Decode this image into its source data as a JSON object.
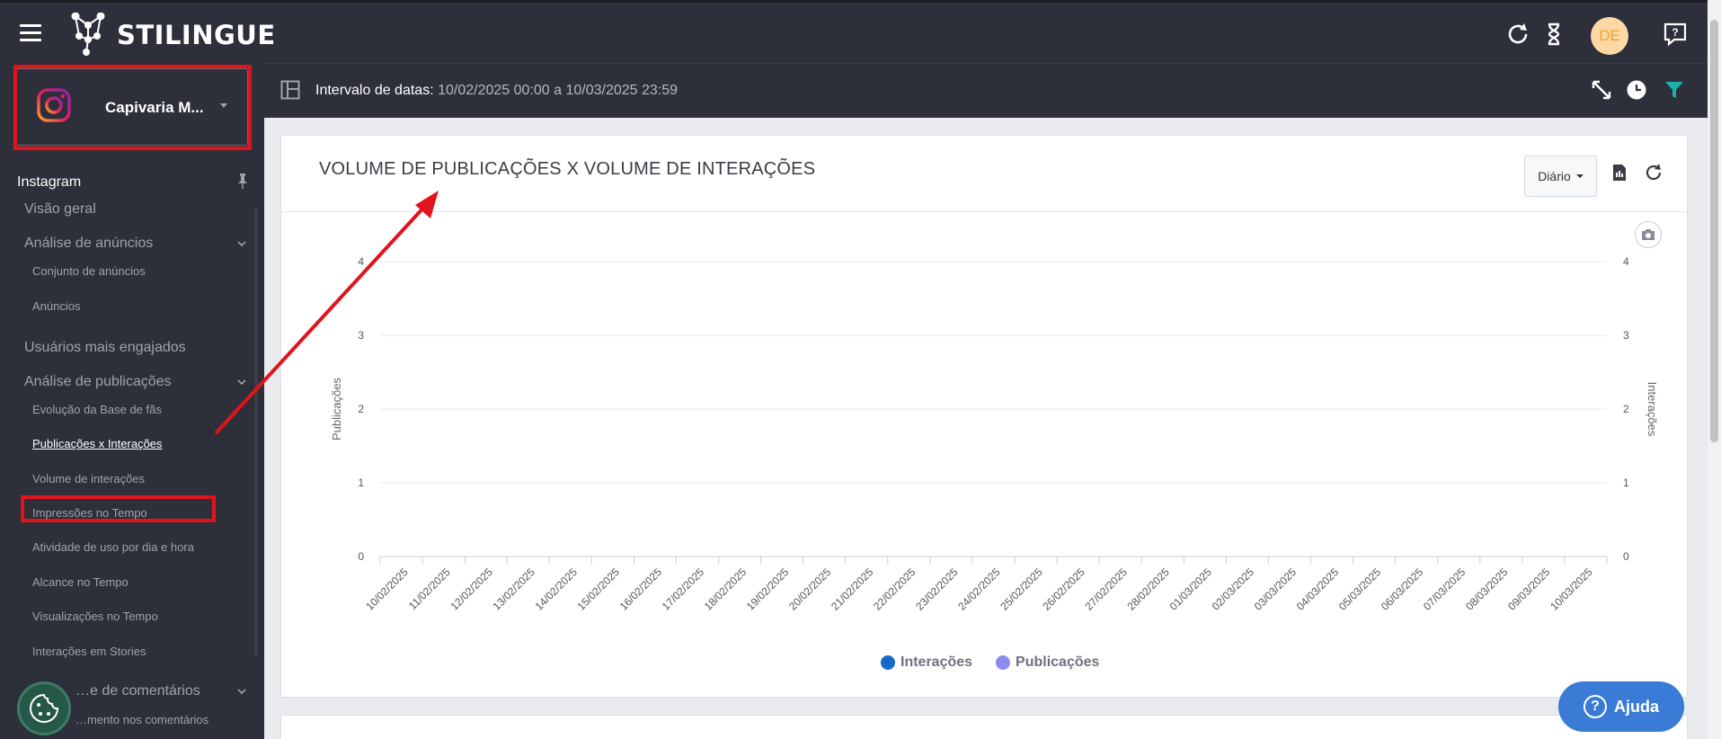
{
  "header": {
    "logo_text": "STILINGUE",
    "avatar_initials": "DE"
  },
  "account": {
    "name": "Capivaria M..."
  },
  "sidebar": {
    "section": "Instagram",
    "items": [
      {
        "label": "Visão geral"
      },
      {
        "label": "Análise de anúncios"
      },
      {
        "label": "Conjunto de anúncios"
      },
      {
        "label": "Anúncios"
      },
      {
        "label": "Usuários mais engajados"
      },
      {
        "label": "Análise de publicações"
      },
      {
        "label": "Evolução da Base de fãs"
      },
      {
        "label": "Publicações x Interações"
      },
      {
        "label": "Volume de interações"
      },
      {
        "label": "Impressões no Tempo"
      },
      {
        "label": "Atividade de uso por dia e hora"
      },
      {
        "label": "Alcance no Tempo"
      },
      {
        "label": "Visualizações no Tempo"
      },
      {
        "label": "Interações em Stories"
      },
      {
        "label": "…e de comentários"
      },
      {
        "label": "…mento nos comentários"
      }
    ]
  },
  "filter": {
    "label": "Intervalo de datas",
    "value": " 10/02/2025 00:00 a 10/03/2025 23:59"
  },
  "card": {
    "title": "VOLUME DE PUBLICAÇÕES X VOLUME DE INTERAÇÕES",
    "period": "Diário"
  },
  "help": {
    "label": "Ajuda"
  },
  "colors": {
    "interacoes": "#1569c7",
    "publicacoes": "#8c8cf0",
    "highlight": "#e0141b"
  },
  "chart_data": {
    "type": "line",
    "ylabel_left": "Publicações",
    "ylabel_right": "Interações",
    "ylim": [
      0,
      4
    ],
    "yticks": [
      "0",
      "1",
      "2",
      "3",
      "4"
    ],
    "categories": [
      "10/02/2025",
      "11/02/2025",
      "12/02/2025",
      "13/02/2025",
      "14/02/2025",
      "15/02/2025",
      "16/02/2025",
      "17/02/2025",
      "18/02/2025",
      "19/02/2025",
      "20/02/2025",
      "21/02/2025",
      "22/02/2025",
      "23/02/2025",
      "24/02/2025",
      "25/02/2025",
      "26/02/2025",
      "27/02/2025",
      "28/02/2025",
      "01/03/2025",
      "02/03/2025",
      "03/03/2025",
      "04/03/2025",
      "05/03/2025",
      "06/03/2025",
      "07/03/2025",
      "08/03/2025",
      "09/03/2025",
      "10/03/2025"
    ],
    "series": [
      {
        "name": "Interações",
        "values": []
      },
      {
        "name": "Publicações",
        "values": []
      }
    ],
    "legend": "bottom",
    "grid": true
  }
}
